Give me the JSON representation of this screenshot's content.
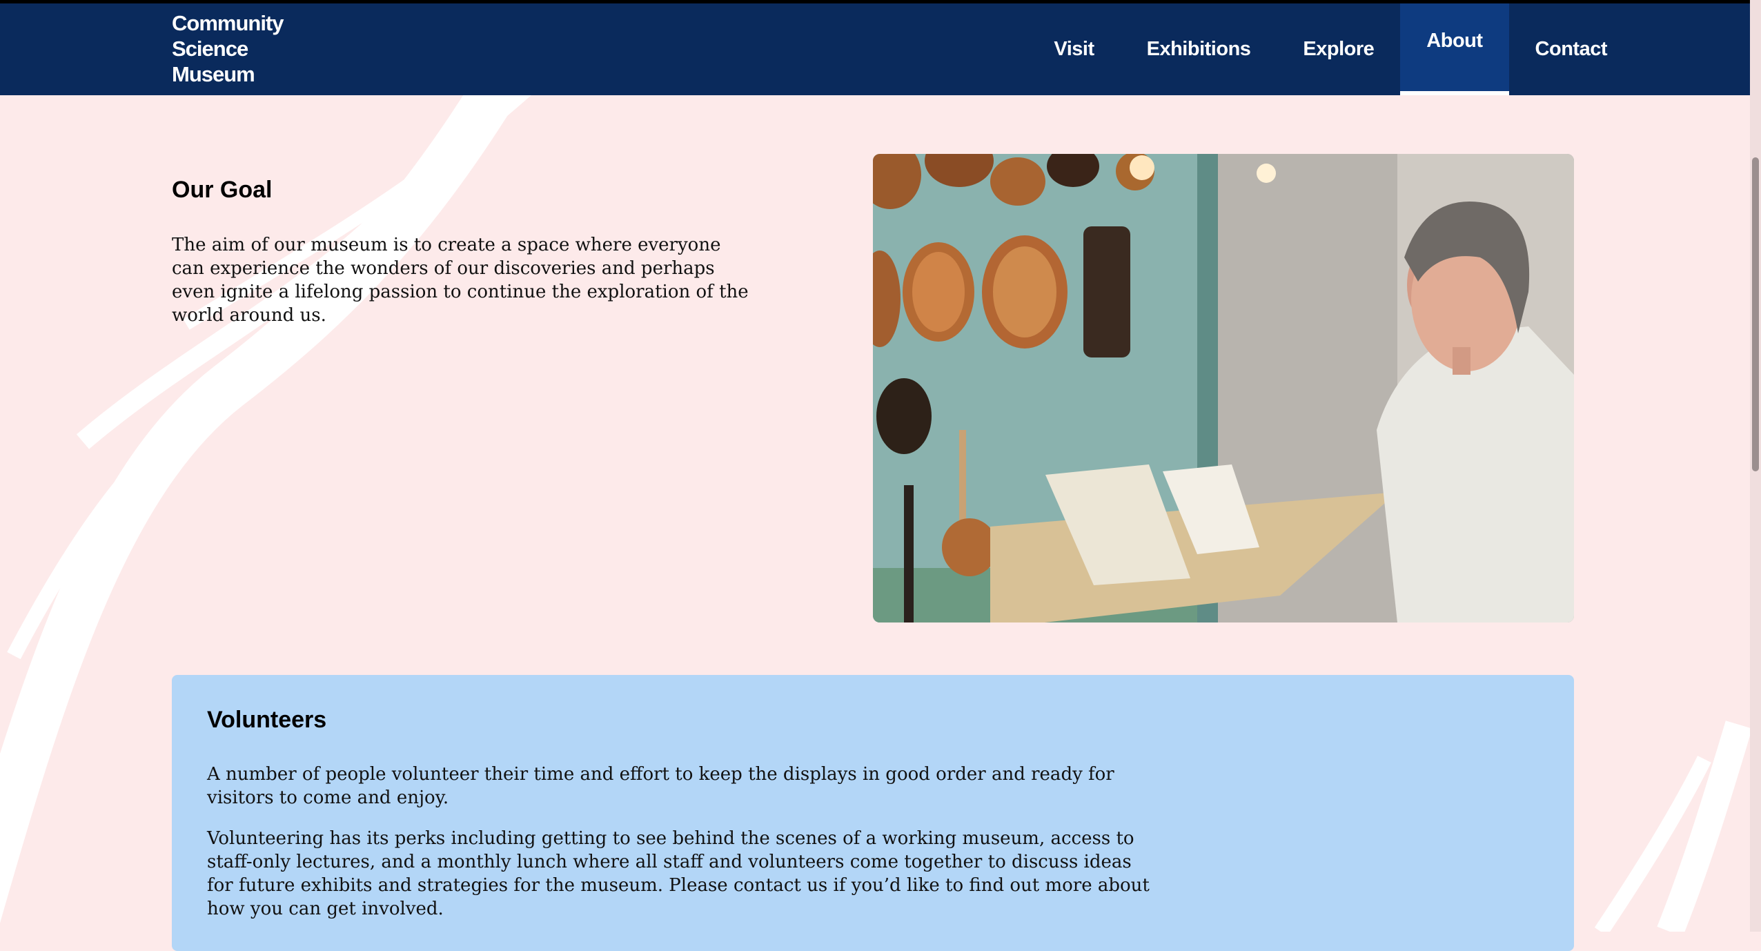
{
  "header": {
    "logo_lines": [
      "Community",
      "Science",
      "Museum"
    ],
    "nav": [
      {
        "label": "Visit"
      },
      {
        "label": "Exhibitions"
      },
      {
        "label": "Explore"
      },
      {
        "label": "About",
        "active": true
      },
      {
        "label": "Contact"
      }
    ]
  },
  "goal": {
    "title": "Our Goal",
    "text": "The aim of our museum is to create a space where everyone can experience the wonders of our discoveries and perhaps even ignite a lifelong passion to continue the exploration of the world around us."
  },
  "volunteers": {
    "title": "Volunteers",
    "paragraphs": [
      "A number of people volunteer their time and effort to keep the displays in good order and ready for visitors to come and enjoy.",
      "Volunteering has its perks including getting to see behind the scenes of a working museum, access to staff-only lectures, and a monthly lunch where all staff and volunteers come together to discuss ideas for future exhibits and strategies for the museum. Please contact us if you’d like to find out more about how you can get involved."
    ]
  },
  "colors": {
    "header_bg": "#0a2a5c",
    "nav_active_bg": "#0e3b80",
    "page_bg": "#fdeaea",
    "card_bg": "#b3d6f7"
  },
  "photo": {
    "icon": "museum-volunteer-photo"
  }
}
